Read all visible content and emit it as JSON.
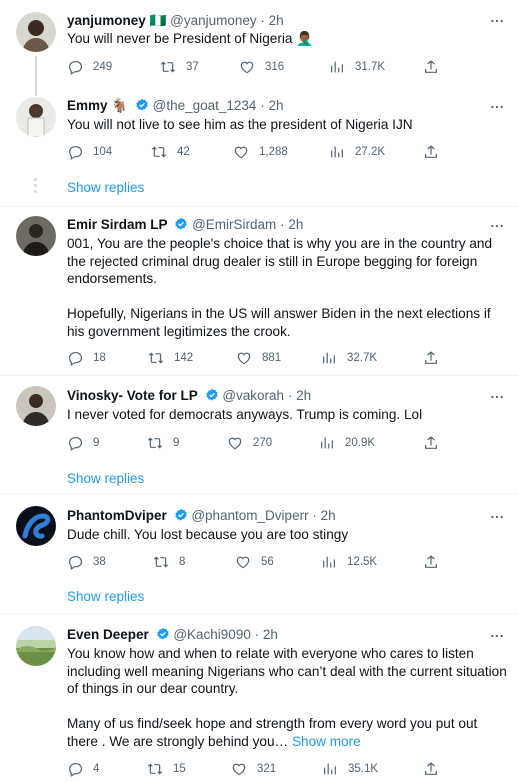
{
  "icons": {
    "reply": "reply-icon",
    "retweet": "retweet-icon",
    "like": "like-icon",
    "views": "views-icon",
    "share": "share-icon",
    "more": "more-icon",
    "verified": "verified-badge-icon"
  },
  "colors": {
    "accent": "#1d9bf0",
    "muted": "#536471",
    "text": "#0f1419",
    "divider": "#eff3f4"
  },
  "show_replies_label": "Show replies",
  "tweets": [
    {
      "name": "yanjumoney",
      "name_emoji": "🇳🇬",
      "handle": "@yanjumoney",
      "time": "2h",
      "text": [
        "You will never be President of Nigeria 🤦🏾‍♂️"
      ],
      "replies": "249",
      "retweets": "37",
      "likes": "316",
      "views": "31.7K"
    },
    {
      "name": "Emmy",
      "name_emoji": "🐐",
      "verified": true,
      "handle": "@the_goat_1234",
      "time": "2h",
      "text": [
        "You will not live to see him as the president of Nigeria IJN"
      ],
      "replies": "104",
      "retweets": "42",
      "likes": "1,288",
      "views": "27.2K"
    },
    {
      "name": "Emir Sirdam LP",
      "verified": true,
      "handle": "@EmirSirdam",
      "time": "2h",
      "text": [
        "001, You are the people's choice that is why you are in the country and the rejected criminal drug dealer is still in Europe begging for foreign endorsements.",
        "Hopefully, Nigerians in the US will answer Biden in the next elections if his government legitimizes the crook."
      ],
      "replies": "18",
      "retweets": "142",
      "likes": "881",
      "views": "32.7K"
    },
    {
      "name": "Vinosky- Vote for LP",
      "verified": true,
      "handle": "@vakorah",
      "time": "2h",
      "text": [
        "I never voted for democrats anyways. Trump is coming. Lol"
      ],
      "replies": "9",
      "retweets": "9",
      "likes": "270",
      "views": "20.9K"
    },
    {
      "name": "PhantomDviper",
      "verified": true,
      "handle": "@phantom_Dviperr",
      "time": "2h",
      "text": [
        "Dude chill.  You lost because you are too stingy"
      ],
      "replies": "38",
      "retweets": "8",
      "likes": "56",
      "views": "12.5K"
    },
    {
      "name": "Even Deeper",
      "verified": true,
      "handle": "@Kachi9090",
      "time": "2h",
      "text": [
        "You know how and when to relate with everyone who cares to listen including well meaning Nigerians who can’t deal with the current situation of things in our dear country.",
        "Many of us find/seek hope and strength from every word you put out there . We are strongly behind you…"
      ],
      "show_more": "Show more",
      "replies": "4",
      "retweets": "15",
      "likes": "321",
      "views": "35.1K"
    }
  ]
}
